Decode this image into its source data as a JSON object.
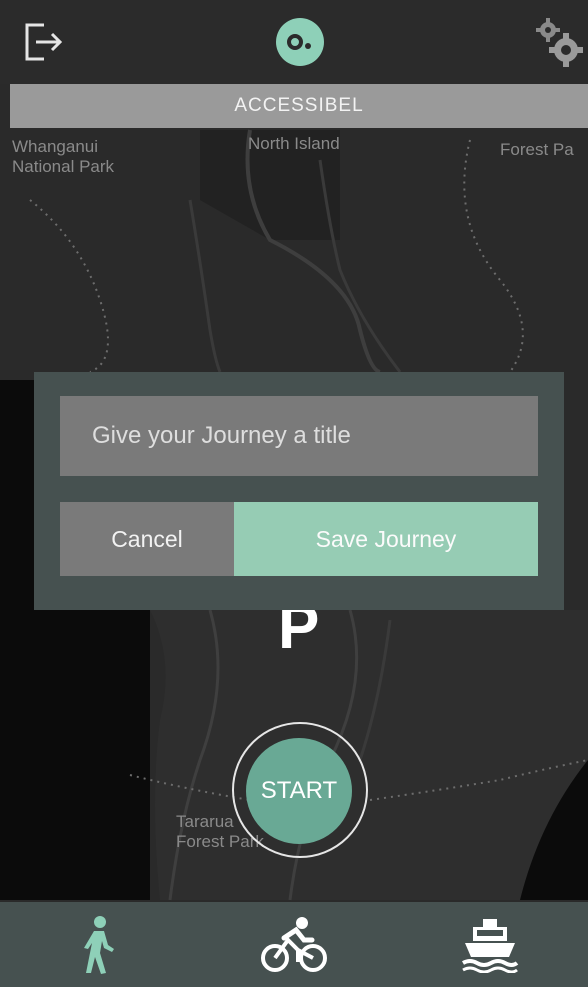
{
  "app": {
    "title": "ACCESSIBEL",
    "accent_color": "#96ccb4",
    "icons": {
      "logout": "logout-icon",
      "logo": "logo-icon",
      "settings": "gear-icon"
    }
  },
  "map": {
    "labels": {
      "whanganui": "Whanganui\nNational Park",
      "north_island": "North Island",
      "forest_park_right": "Forest Pa",
      "tararua": "Tararua\nForest Park"
    },
    "parking_marker": "P"
  },
  "dialog": {
    "title_placeholder": "Give your Journey a title",
    "cancel_label": "Cancel",
    "save_label": "Save Journey"
  },
  "start": {
    "label": "START"
  },
  "bottom_nav": {
    "items": [
      {
        "icon": "walk-icon",
        "active": true
      },
      {
        "icon": "bike-icon",
        "active": false
      },
      {
        "icon": "ship-icon",
        "active": false
      }
    ]
  }
}
